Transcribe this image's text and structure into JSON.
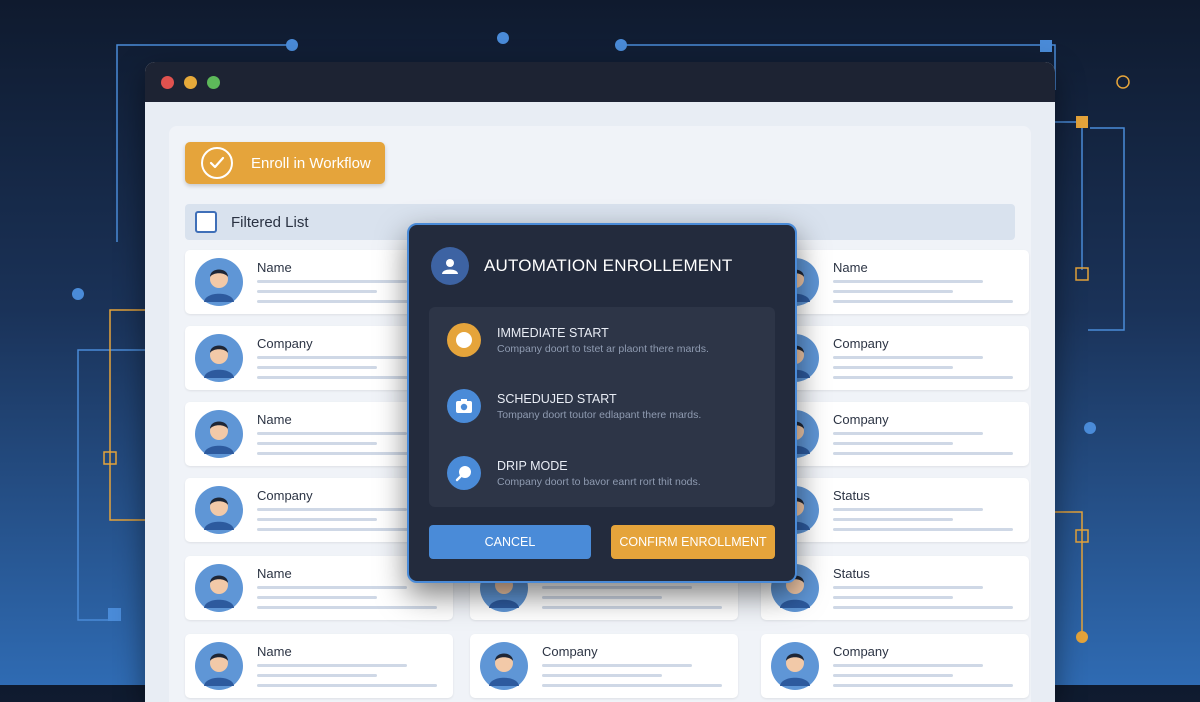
{
  "window": {
    "controls": [
      {
        "name": "close-dot",
        "color": "#e0524f"
      },
      {
        "name": "minimize-dot",
        "color": "#e6a93a"
      },
      {
        "name": "maximize-dot",
        "color": "#5db85a"
      }
    ]
  },
  "toolbar": {
    "enroll_label": "Enroll in Workflow",
    "enroll_icon": "check-circle-icon"
  },
  "filter": {
    "label": "Filtered List"
  },
  "list": {
    "columns": [
      [
        "Name",
        "Company",
        "Name",
        "Company",
        "Name",
        "Name"
      ],
      [
        "",
        "",
        "",
        "",
        "",
        "Company"
      ],
      [
        "Name",
        "Company",
        "Company",
        "Status",
        "Status",
        "Company"
      ]
    ]
  },
  "modal": {
    "title": "AUTOMATION ENROLLEMENT",
    "header_icon": "user-icon",
    "options": [
      {
        "title": "IMMEDIATE START",
        "desc": "Company doort to tstet ar plaont there mards.",
        "icon": "radio-selected-icon",
        "color": "#e5a43b"
      },
      {
        "title": "SCHEDUJED START",
        "desc": "Tompany doort toutor edlapant there mards.",
        "icon": "camera-icon",
        "color": "#4a8bd8"
      },
      {
        "title": "DRIP MODE",
        "desc": "Company doort to bavor eanrt rort thit nods.",
        "icon": "drip-icon",
        "color": "#4a8bd8"
      }
    ],
    "cancel_label": "CANCEL",
    "confirm_label": "CONFIRM ENROLLMENT"
  },
  "colors": {
    "accent_orange": "#e5a43b",
    "accent_blue": "#4a8bd8",
    "modal_bg": "#232b3d"
  }
}
